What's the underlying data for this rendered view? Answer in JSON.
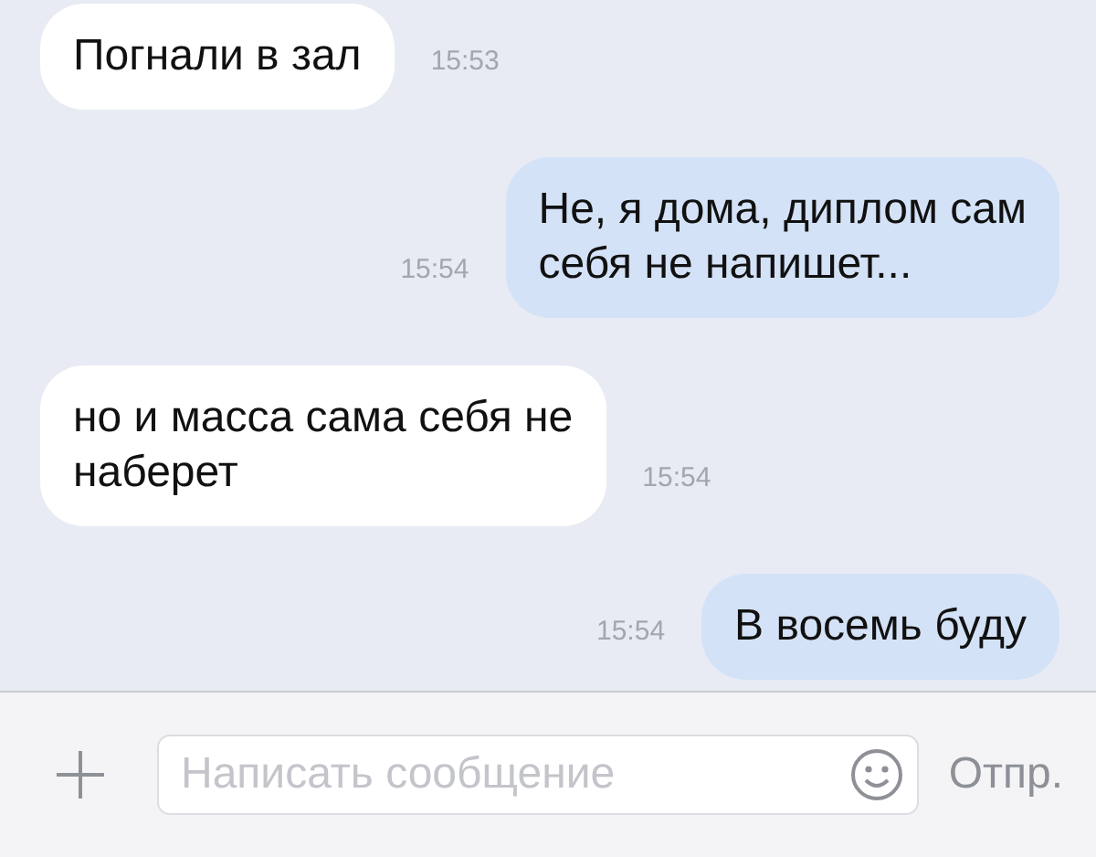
{
  "messages": [
    {
      "text": "Погнали в зал",
      "time": "15:53",
      "outgoing": false
    },
    {
      "text": "Не, я дома, диплом сам\nсебя не напишет...",
      "time": "15:54",
      "outgoing": true
    },
    {
      "text": "но и масса сама себя не\nнаберет",
      "time": "15:54",
      "outgoing": false
    },
    {
      "text": "В восемь буду",
      "time": "15:54",
      "outgoing": true
    }
  ],
  "composer": {
    "placeholder": "Написать сообщение",
    "send": "Отпр."
  }
}
